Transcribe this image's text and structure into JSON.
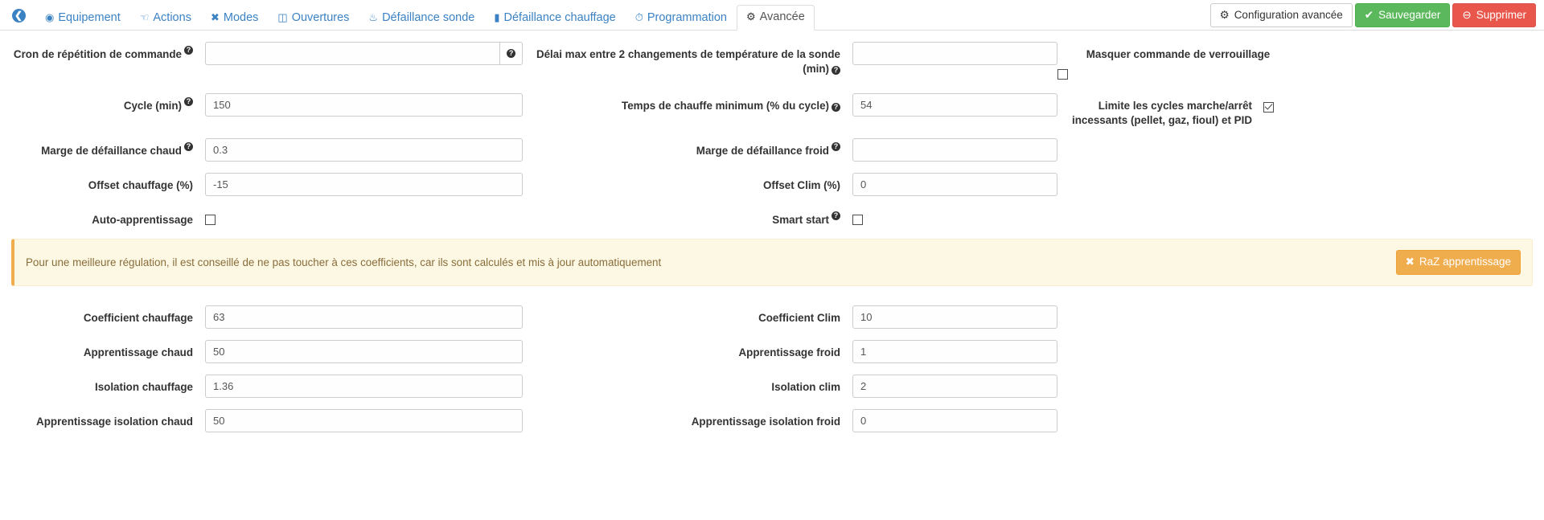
{
  "tabbar": {
    "back_icon": "back-arrow-icon",
    "tabs": [
      {
        "label": "Equipement",
        "icon": "⊙",
        "icon_name": "dashboard-icon",
        "active": false
      },
      {
        "label": "Actions",
        "icon": "☚",
        "icon_name": "hand-icon",
        "active": false
      },
      {
        "label": "Modes",
        "icon": "✖",
        "icon_name": "modes-icon",
        "active": false
      },
      {
        "label": "Ouvertures",
        "icon": "▣",
        "icon_name": "window-icon",
        "active": false
      },
      {
        "label": "Défaillance sonde",
        "icon": "Ὗ",
        "icon_name": "thermometer-icon",
        "active": false
      },
      {
        "label": "Défaillance chauffage",
        "icon": "▮",
        "icon_name": "radiator-icon",
        "active": false
      },
      {
        "label": "Programmation",
        "icon": "◴",
        "icon_name": "clock-icon",
        "active": false
      },
      {
        "label": "Avancée",
        "icon": "⚙",
        "icon_name": "gear-icon",
        "active": true
      }
    ],
    "actions": [
      {
        "label": "Configuration avancée",
        "icon": "⚙",
        "icon_name": "gears-icon",
        "style": "default"
      },
      {
        "label": "Sauvegarder",
        "icon": "✔",
        "icon_name": "check-circle-icon",
        "style": "success"
      },
      {
        "label": "Supprimer",
        "icon": "⊖",
        "icon_name": "minus-circle-icon",
        "style": "danger"
      }
    ]
  },
  "form": {
    "cron_label": "Cron de répétition de commande",
    "cron_value": "",
    "cron_placeholder": "",
    "delai_label": "Délai max entre 2 changements de température de la sonde (min)",
    "delai_value": "",
    "masquer_label": "Masquer commande de verrouillage",
    "masquer_checked": false,
    "cycle_label": "Cycle (min)",
    "cycle_value": "150",
    "temps_chauffe_label": "Temps de chauffe minimum (% du cycle)",
    "temps_chauffe_value": "54",
    "limite_label": "Limite les cycles marche/arrêt incessants (pellet, gaz, fioul) et PID",
    "limite_checked": true,
    "marge_chaud_label": "Marge de défaillance chaud",
    "marge_chaud_value": "0.3",
    "marge_froid_label": "Marge de défaillance froid",
    "marge_froid_value": "",
    "offset_chauffage_label": "Offset chauffage (%)",
    "offset_chauffage_value": "-15",
    "offset_clim_label": "Offset Clim (%)",
    "offset_clim_value": "0",
    "auto_app_label": "Auto-apprentissage",
    "auto_app_checked": false,
    "smart_start_label": "Smart start",
    "smart_start_checked": false,
    "coef_chauffage_label": "Coefficient chauffage",
    "coef_chauffage_value": "63",
    "coef_clim_label": "Coefficient Clim",
    "coef_clim_value": "10",
    "app_chaud_label": "Apprentissage chaud",
    "app_chaud_value": "50",
    "app_froid_label": "Apprentissage froid",
    "app_froid_value": "1",
    "iso_chauffage_label": "Isolation chauffage",
    "iso_chauffage_value": "1.36",
    "iso_clim_label": "Isolation clim",
    "iso_clim_value": "2",
    "app_iso_chaud_label": "Apprentissage isolation chaud",
    "app_iso_chaud_value": "50",
    "app_iso_froid_label": "Apprentissage isolation froid",
    "app_iso_froid_value": "0",
    "help_glyph": "?"
  },
  "alert": {
    "text": "Pour une meilleure régulation, il est conseillé de ne pas toucher à ces coefficients, car ils sont calculés et mis à jour automatiquement",
    "button_label": "RaZ apprentissage",
    "button_icon": "✖"
  },
  "colors": {
    "link": "#3b82c4",
    "success": "#5cb85c",
    "danger": "#e9564b",
    "warning": "#f0ad4e",
    "alert_bg": "#fcf8e3",
    "alert_text": "#8a6d3b"
  }
}
